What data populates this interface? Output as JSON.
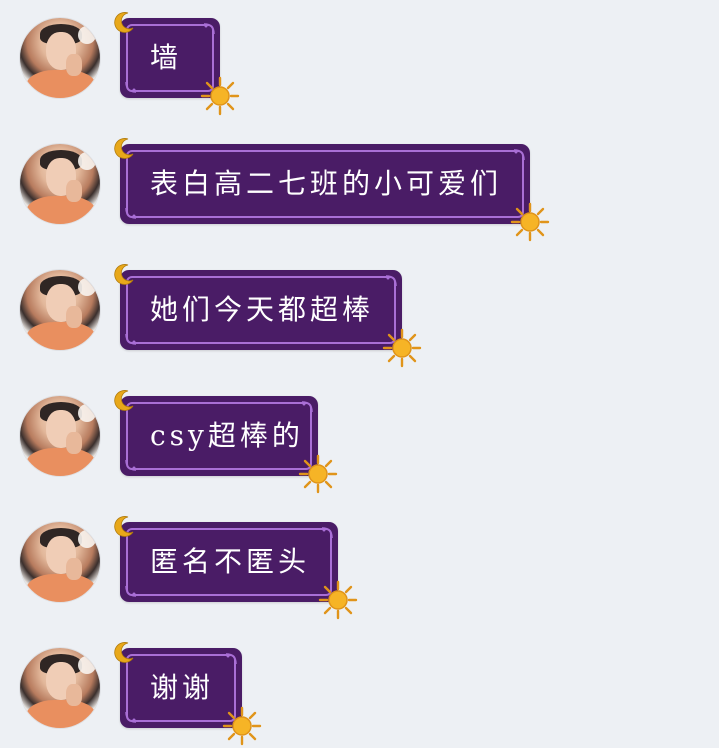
{
  "chat": {
    "messages": [
      {
        "text": "墙"
      },
      {
        "text": "表白高二七班的小可爱们"
      },
      {
        "text": "她们今天都超棒"
      },
      {
        "text": "csy超棒的"
      },
      {
        "text": "匿名不匿头"
      },
      {
        "text": "谢谢"
      }
    ]
  },
  "colors": {
    "background": "#edf0f4",
    "bubble_fill": "#4a1c66",
    "bubble_border": "#a96fd6",
    "text": "#ffffff",
    "sun": "#f6b426",
    "moon": "#e8a81a"
  },
  "icons": {
    "moon": "crescent-moon-icon",
    "sun": "sun-icon",
    "avatar": "avatar"
  }
}
